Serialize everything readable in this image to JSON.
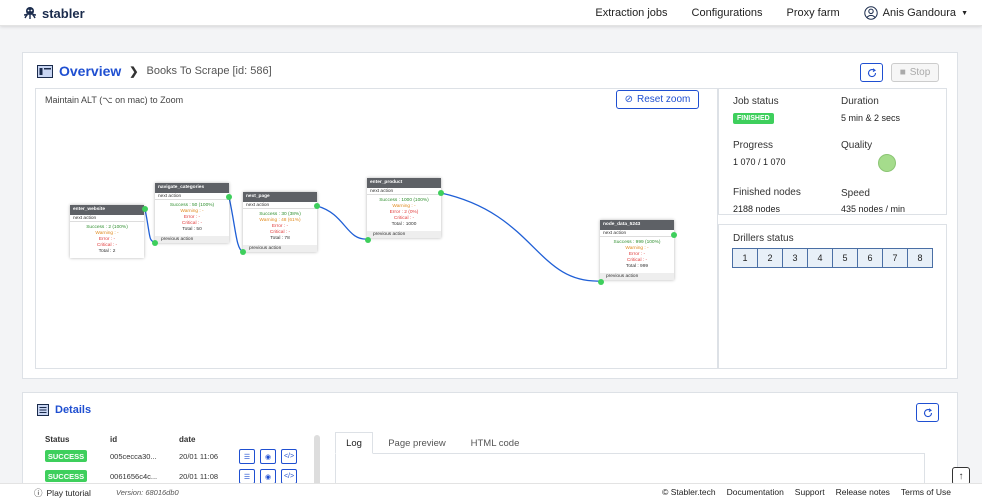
{
  "brand": {
    "name": "stabler"
  },
  "nav": {
    "links": [
      "Extraction jobs",
      "Configurations",
      "Proxy farm"
    ],
    "user": "Anis Gandoura"
  },
  "overview": {
    "title": "Overview",
    "subtitle": "Books To Scrape [id: 586]",
    "stop_label": "Stop",
    "zoom_hint": "Maintain ALT (⌥ on mac) to Zoom",
    "reset_zoom": "Reset zoom",
    "nodes": [
      {
        "name": "enter_website",
        "sub": "next action",
        "success": "Success : 2 (100%)",
        "warning": "Warning : -",
        "error": "Error : -",
        "critical": "Critical : -",
        "total": "Total : 2",
        "footer": ""
      },
      {
        "name": "navigate_categories",
        "sub": "next action",
        "success": "Success : 50 (100%)",
        "warning": "Warning : -",
        "error": "Error : -",
        "critical": "Critical : -",
        "total": "Total : 50",
        "footer": "previous action"
      },
      {
        "name": "next_page",
        "sub": "next action",
        "success": "Success : 30 (38%)",
        "warning": "Warning : 48 (61%)",
        "error": "Error : -",
        "critical": "Critical : -",
        "total": "Total : 78",
        "footer": "previous action"
      },
      {
        "name": "enter_product",
        "sub": "next action",
        "success": "Success : 1000 (100%)",
        "warning": "Warning : -",
        "error": "Error : 2 (0%)",
        "critical": "Critical : -",
        "total": "Total : 1000",
        "footer": "previous action"
      },
      {
        "name": "node_data_5243",
        "sub": "next action",
        "success": "Success : 999 (100%)",
        "warning": "Warning : -",
        "error": "Error : -",
        "critical": "Critical : -",
        "total": "Total : 999",
        "footer": "previous action"
      }
    ],
    "job_status_label": "Job status",
    "job_status": "FINISHED",
    "duration_label": "Duration",
    "duration": "5 min & 2 secs",
    "progress_label": "Progress",
    "progress": "1 070 / 1 070",
    "quality_label": "Quality",
    "finished_nodes_label": "Finished nodes",
    "finished_nodes": "2188 nodes",
    "speed_label": "Speed",
    "speed": "435 nodes / min",
    "drillers_label": "Drillers status",
    "drillers": [
      "1",
      "2",
      "3",
      "4",
      "5",
      "6",
      "7",
      "8"
    ]
  },
  "details": {
    "title": "Details",
    "columns": [
      "Status",
      "id",
      "date"
    ],
    "rows": [
      {
        "status": "SUCCESS",
        "id": "005cecca30...",
        "date": "20/01 11:06"
      },
      {
        "status": "SUCCESS",
        "id": "0061656c4c...",
        "date": "20/01 11:08"
      }
    ],
    "tabs": [
      "Log",
      "Page preview",
      "HTML code"
    ]
  },
  "footer": {
    "tutorial": "Play tutorial",
    "version": "Version: 68016db0",
    "links": [
      "© Stabler.tech",
      "Documentation",
      "Support",
      "Release notes",
      "Terms of Use"
    ]
  },
  "colors": {
    "accent": "#1f4fd1",
    "success": "#3ecf5c",
    "edge": "#1f5fd6"
  }
}
